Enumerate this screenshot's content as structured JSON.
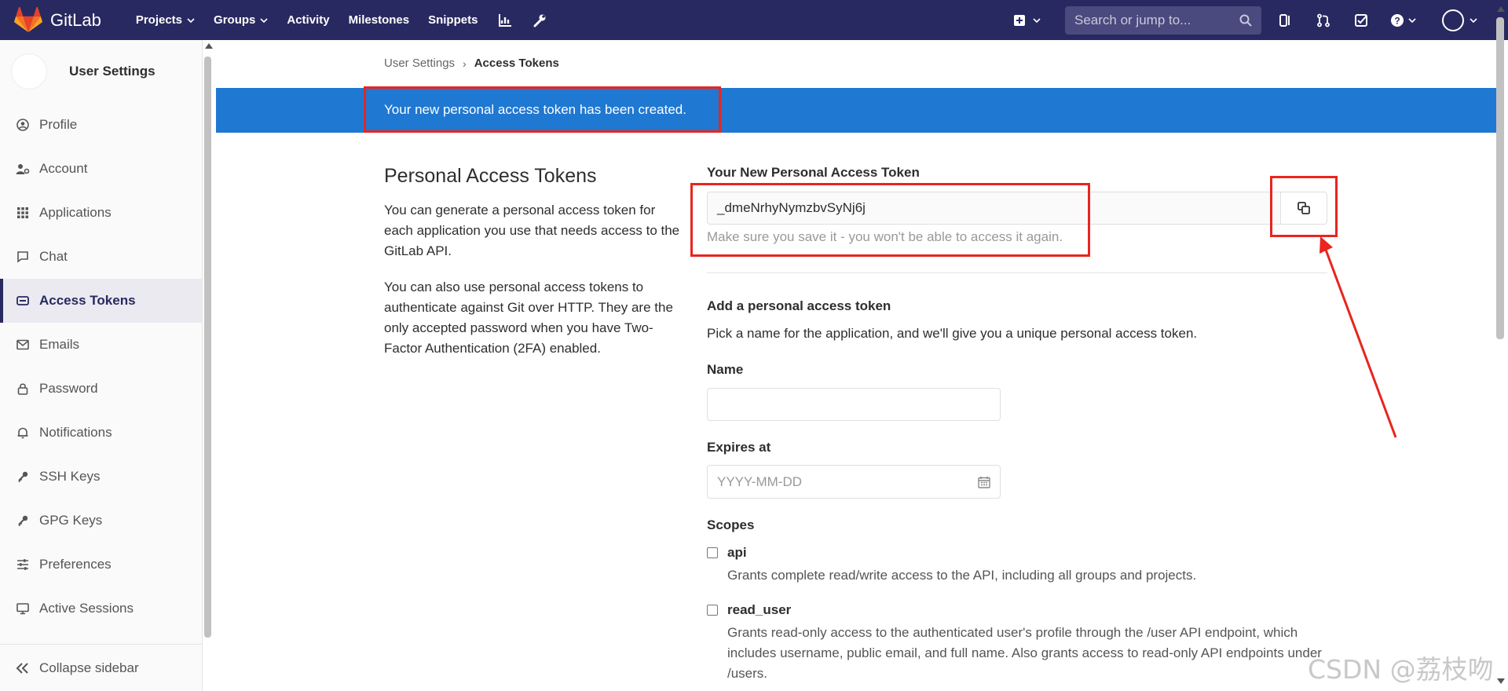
{
  "navbar": {
    "brand": "GitLab",
    "links": [
      "Projects",
      "Groups",
      "Activity",
      "Milestones",
      "Snippets"
    ],
    "search_placeholder": "Search or jump to..."
  },
  "sidebar": {
    "title": "User Settings",
    "items": [
      {
        "label": "Profile",
        "icon": "profile-icon"
      },
      {
        "label": "Account",
        "icon": "account-icon"
      },
      {
        "label": "Applications",
        "icon": "applications-icon"
      },
      {
        "label": "Chat",
        "icon": "chat-icon"
      },
      {
        "label": "Access Tokens",
        "icon": "token-icon",
        "active": true
      },
      {
        "label": "Emails",
        "icon": "mail-icon"
      },
      {
        "label": "Password",
        "icon": "lock-icon"
      },
      {
        "label": "Notifications",
        "icon": "bell-icon"
      },
      {
        "label": "SSH Keys",
        "icon": "key-icon"
      },
      {
        "label": "GPG Keys",
        "icon": "key-icon"
      },
      {
        "label": "Preferences",
        "icon": "sliders-icon"
      },
      {
        "label": "Active Sessions",
        "icon": "monitor-icon"
      }
    ],
    "collapse_label": "Collapse sidebar"
  },
  "breadcrumb": {
    "parent": "User Settings",
    "current": "Access Tokens"
  },
  "flash": {
    "message": "Your new personal access token has been created."
  },
  "intro": {
    "title": "Personal Access Tokens",
    "para1": "You can generate a personal access token for each application you use that needs access to the GitLab API.",
    "para2": "You can also use personal access tokens to authenticate against Git over HTTP. They are the only accepted password when you have Two-Factor Authentication (2FA) enabled."
  },
  "new_token": {
    "label": "Your New Personal Access Token",
    "value": "_dmeNrhyNymzbvSyNj6j",
    "hint": "Make sure you save it - you won't be able to access it again."
  },
  "form": {
    "title": "Add a personal access token",
    "description": "Pick a name for the application, and we'll give you a unique personal access token.",
    "name_label": "Name",
    "expires_label": "Expires at",
    "expires_placeholder": "YYYY-MM-DD",
    "scopes_label": "Scopes",
    "scopes": [
      {
        "name": "api",
        "description": "Grants complete read/write access to the API, including all groups and projects."
      },
      {
        "name": "read_user",
        "description": "Grants read-only access to the authenticated user's profile through the /user API endpoint, which includes username, public email, and full name. Also grants access to read-only API endpoints under /users."
      }
    ]
  },
  "watermark": "CSDN @荔枝吻",
  "colors": {
    "navbar": "#292961",
    "flash": "#1f78d1",
    "annotation": "#e8251e"
  }
}
